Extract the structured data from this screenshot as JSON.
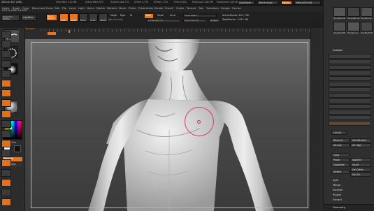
{
  "titlebar": {
    "title": "ZBrush 4R7 (x64)",
    "readouts": [
      "Free Mem 1.23 GB",
      "Active Mem 974",
      "Scratch Disk 171",
      "ZTime 1.774",
      "RTime 1.233",
      "Timer 0.002",
      "PolyCount 1.85 MP",
      "PointCount 1.84 MP"
    ],
    "right_buttons": [
      "QuickSave",
      "See-through",
      "Menus",
      "DefaultZScript"
    ]
  },
  "menu": [
    "Alpha",
    "Brush",
    "Color",
    "Document",
    "Draw",
    "Edit",
    "File",
    "Layer",
    "Light",
    "Macro",
    "Marker",
    "Material",
    "Movie",
    "Picker",
    "Preferences",
    "Render",
    "Stencil",
    "Stroke",
    "Texture",
    "Tool",
    "Transform",
    "Zplugin",
    "Zscript"
  ],
  "status": {
    "counter": "0.2171,0.0877,0.9417",
    "projection_master": "Projection Master",
    "lightbox": "LightBox",
    "quick_sketch": "Quick Sketch",
    "edit": "Edit",
    "draw": "Draw",
    "move": "Move",
    "scale": "Scale",
    "rotate": "Rotate",
    "mrgb": "Mrgb",
    "rgb": "Rgb",
    "m": "M",
    "zadd": "Zadd",
    "zsub": "Zsub",
    "zcut": "Zcut",
    "rgb_intensity": "Rgb Intensity",
    "z_intensity": "Z Intensity 25",
    "focal_shift": "Focal Shift 0",
    "draw_size": "Draw Size 64",
    "dynamic": "Dynamic",
    "active_points": "ActivePoints: 611,790",
    "total_points": "TotalPoints: 1.911 Mil"
  },
  "left": {
    "camera_label": "Camera",
    "swatch_label": "SwitchColor",
    "alternate": "Alternate",
    "colors": {
      "fg": "#ffffff",
      "bg": "#111111",
      "accent": "#e8751e"
    }
  },
  "tray": {
    "tools": [
      "PolyMesh3D",
      "SimpleBrush",
      "PolySphere",
      "PolyMesh3D",
      "PolySphere",
      "PolyMesh3D"
    ],
    "subtool_title": "Subtool",
    "subtools": [
      "",
      "",
      "",
      "",
      "",
      "",
      "",
      "",
      "",
      ""
    ],
    "list_all": "List All",
    "rename": "Rename",
    "autoreorder": "AutoReorder",
    "all_low": "All Low",
    "all_high": "All High",
    "copy": "Copy",
    "paste": "Paste",
    "duplicate": "Duplicate",
    "append": "Append",
    "insert": "Insert",
    "delete": "Delete",
    "del_other": "Del Other",
    "del_all": "Del All",
    "split": "Split",
    "merge": "Merge",
    "remesh": "Remesh",
    "project": "Project",
    "extract": "Extract",
    "geometry": "Geometry"
  }
}
